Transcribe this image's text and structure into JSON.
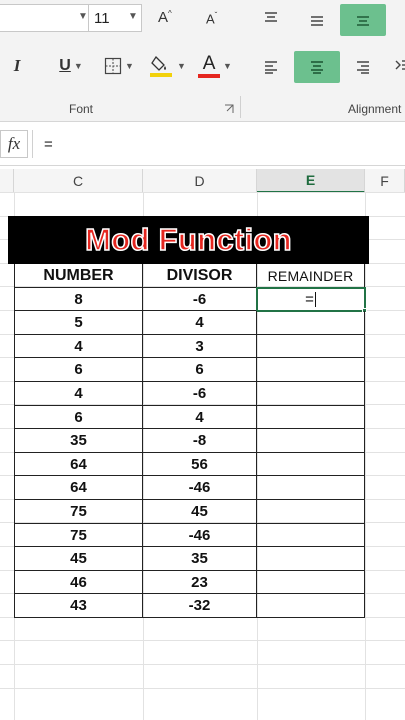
{
  "ribbon": {
    "font_size": "11",
    "grow_font_label": "A",
    "shrink_font_label": "A",
    "italic_label": "I",
    "underline_label": "U",
    "font_color_label": "A",
    "font_group_label": "Font",
    "alignment_group_label": "Alignment",
    "fill_color": "#f2d10b",
    "font_color": "#e5261f",
    "active_align_color": "#6cc08e"
  },
  "formula_bar": {
    "fx_label": "fx",
    "value": "="
  },
  "columns": [
    "C",
    "D",
    "E",
    "F"
  ],
  "selected_column": "E",
  "title": "Mod Function",
  "table": {
    "headers": [
      "NUMBER",
      "DIVISOR",
      "REMAINDER"
    ],
    "rows": [
      {
        "number": "8",
        "divisor": "-6",
        "remainder": "="
      },
      {
        "number": "5",
        "divisor": "4",
        "remainder": ""
      },
      {
        "number": "4",
        "divisor": "3",
        "remainder": ""
      },
      {
        "number": "6",
        "divisor": "6",
        "remainder": ""
      },
      {
        "number": "4",
        "divisor": "-6",
        "remainder": ""
      },
      {
        "number": "6",
        "divisor": "4",
        "remainder": ""
      },
      {
        "number": "35",
        "divisor": "-8",
        "remainder": ""
      },
      {
        "number": "64",
        "divisor": "56",
        "remainder": ""
      },
      {
        "number": "64",
        "divisor": "-46",
        "remainder": ""
      },
      {
        "number": "75",
        "divisor": "45",
        "remainder": ""
      },
      {
        "number": "75",
        "divisor": "-46",
        "remainder": ""
      },
      {
        "number": "45",
        "divisor": "35",
        "remainder": ""
      },
      {
        "number": "46",
        "divisor": "23",
        "remainder": ""
      },
      {
        "number": "43",
        "divisor": "-32",
        "remainder": ""
      }
    ]
  }
}
